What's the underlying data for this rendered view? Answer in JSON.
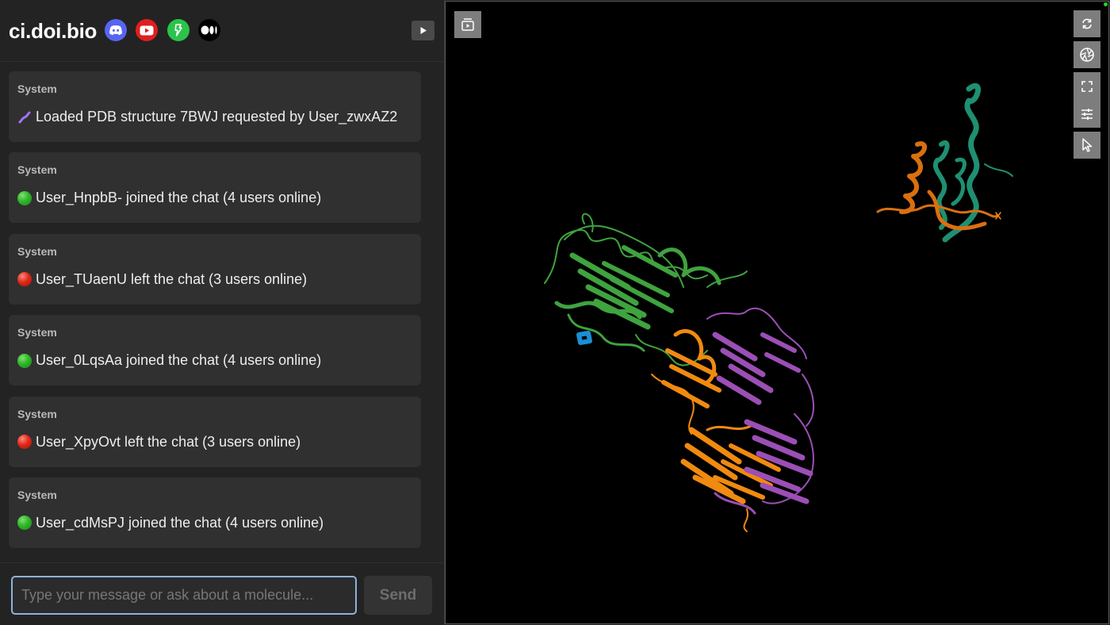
{
  "header": {
    "brand": "ci.doi.bio",
    "social_icons": [
      "discord-icon",
      "youtube-icon",
      "green-brand-icon",
      "medium-icon"
    ],
    "panel_toggle_icon": "play-icon"
  },
  "messages": [
    {
      "sender": "System",
      "icon": "dna-icon",
      "text": "Loaded PDB structure 7BWJ requested by User_zwxAZ2"
    },
    {
      "sender": "System",
      "icon": "green-circle-icon",
      "text": "User_HnpbB- joined the chat (4 users online)"
    },
    {
      "sender": "System",
      "icon": "red-circle-icon",
      "text": "User_TUaenU left the chat (3 users online)"
    },
    {
      "sender": "System",
      "icon": "green-circle-icon",
      "text": "User_0LqsAa joined the chat (4 users online)"
    },
    {
      "sender": "System",
      "icon": "red-circle-icon",
      "text": "User_XpyOvt left the chat (3 users online)"
    },
    {
      "sender": "System",
      "icon": "green-circle-icon",
      "text": "User_cdMsPJ joined the chat (4 users online)"
    }
  ],
  "input": {
    "value": "",
    "placeholder": "Type your message or ask about a molecule...",
    "send_label": "Send"
  },
  "viewer": {
    "controls": [
      "sequence-panel-icon",
      "reset-camera-icon",
      "screenshot-icon",
      "fullscreen-icon",
      "settings-sliders-icon",
      "selection-cursor-icon"
    ],
    "chain_colors": {
      "green": "#3fa33f",
      "orange": "#f08a10",
      "purple": "#9b4fb5",
      "teal": "#1f8f72",
      "dark_orange": "#d9700f",
      "ligand_blue": "#1a8fd6"
    }
  }
}
